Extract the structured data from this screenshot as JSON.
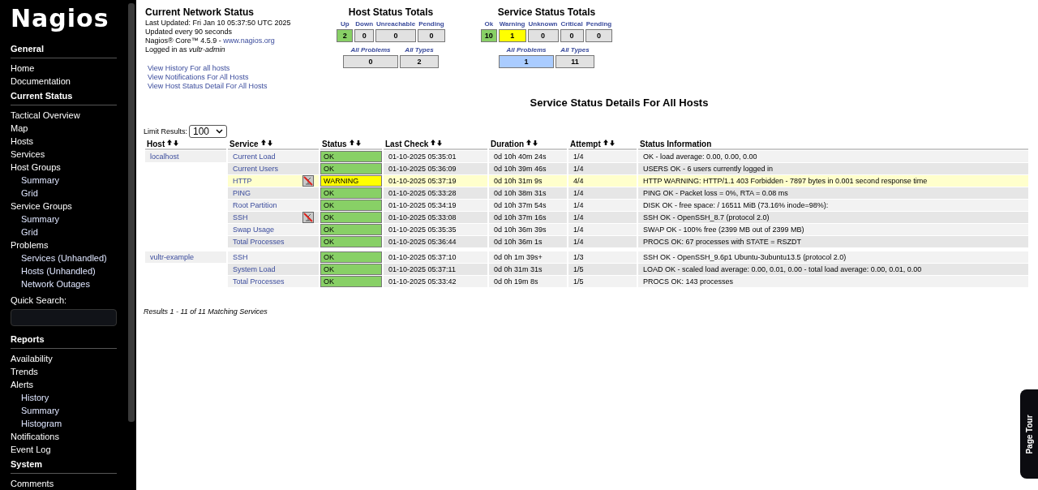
{
  "sidebar": {
    "logo": "Nagios",
    "sections": [
      {
        "title": "General",
        "items": [
          {
            "label": "Home"
          },
          {
            "label": "Documentation"
          }
        ]
      },
      {
        "title": "Current Status",
        "items": [
          {
            "label": "Tactical Overview"
          },
          {
            "label": "Map"
          },
          {
            "label": "Hosts"
          },
          {
            "label": "Services"
          },
          {
            "label": "Host Groups",
            "children": [
              {
                "label": "Summary"
              },
              {
                "label": "Grid"
              }
            ]
          },
          {
            "label": "Service Groups",
            "children": [
              {
                "label": "Summary"
              },
              {
                "label": "Grid"
              }
            ]
          },
          {
            "label": "Problems",
            "children": [
              {
                "label": "Services (Unhandled)"
              },
              {
                "label": "Hosts (Unhandled)"
              },
              {
                "label": "Network Outages"
              }
            ]
          }
        ],
        "search_label": "Quick Search:"
      },
      {
        "title": "Reports",
        "items": [
          {
            "label": "Availability"
          },
          {
            "label": "Trends"
          },
          {
            "label": "Alerts",
            "children": [
              {
                "label": "History"
              },
              {
                "label": "Summary"
              },
              {
                "label": "Histogram"
              }
            ]
          },
          {
            "label": "Notifications"
          },
          {
            "label": "Event Log"
          }
        ]
      },
      {
        "title": "System",
        "items": [
          {
            "label": "Comments"
          }
        ]
      }
    ]
  },
  "network_status": {
    "title": "Current Network Status",
    "last_updated": "Last Updated: Fri Jan 10 05:37:50 UTC 2025",
    "interval": "Updated every 90 seconds",
    "version": "Nagios® Core™ 4.5.9 - ",
    "version_link": "www.nagios.org",
    "logged_in": "Logged in as *vultr-admin*",
    "links": [
      "View History For all hosts",
      "View Notifications For All Hosts",
      "View Host Status Detail For All Hosts"
    ]
  },
  "host_totals": {
    "title": "Host Status Totals",
    "counts": [
      {
        "label": "Up",
        "count": "2",
        "color": "#88d066"
      },
      {
        "label": "Down",
        "count": "0",
        "color": "#e1e1e1"
      },
      {
        "label": "Unreachable",
        "count": "0",
        "color": "#e1e1e1"
      },
      {
        "label": "Pending",
        "count": "0",
        "color": "#e1e1e1"
      }
    ],
    "summary": [
      {
        "label": "All Problems",
        "count": "0",
        "color": "#e1e1e1"
      },
      {
        "label": "All Types",
        "count": "2",
        "color": "#e1e1e1"
      }
    ]
  },
  "service_totals": {
    "title": "Service Status Totals",
    "counts": [
      {
        "label": "Ok",
        "count": "10",
        "color": "#88d066"
      },
      {
        "label": "Warning",
        "count": "1",
        "color": "#ffff00"
      },
      {
        "label": "Unknown",
        "count": "0",
        "color": "#e1e1e1"
      },
      {
        "label": "Critical",
        "count": "0",
        "color": "#e1e1e1"
      },
      {
        "label": "Pending",
        "count": "0",
        "color": "#e1e1e1"
      }
    ],
    "summary": [
      {
        "label": "All Problems",
        "count": "1",
        "color": "#aaccff"
      },
      {
        "label": "All Types",
        "count": "11",
        "color": "#e1e1e1"
      }
    ]
  },
  "details": {
    "title": "Service Status Details For All Hosts",
    "limit_label": "Limit Results:",
    "limit_value": "100",
    "columns": [
      {
        "label": "Host",
        "sortable": true
      },
      {
        "label": "Service",
        "sortable": true
      },
      {
        "label": "Status",
        "sortable": true
      },
      {
        "label": "Last Check",
        "sortable": true
      },
      {
        "label": "Duration",
        "sortable": true
      },
      {
        "label": "Attempt",
        "sortable": true
      },
      {
        "label": "Status Information",
        "sortable": false
      }
    ],
    "hosts": [
      {
        "name": "localhost",
        "services": [
          {
            "name": "Current Load",
            "notifications_disabled": false,
            "status": "OK",
            "kind": "ok",
            "last_check": "01-10-2025 05:35:01",
            "duration": "0d 10h 40m 24s",
            "attempt": "1/4",
            "info": "OK - load average: 0.00, 0.00, 0.00"
          },
          {
            "name": "Current Users",
            "notifications_disabled": false,
            "status": "OK",
            "kind": "ok",
            "last_check": "01-10-2025 05:36:09",
            "duration": "0d 10h 39m 46s",
            "attempt": "1/4",
            "info": "USERS OK - 6 users currently logged in"
          },
          {
            "name": "HTTP",
            "notifications_disabled": true,
            "status": "WARNING",
            "kind": "warning",
            "last_check": "01-10-2025 05:37:19",
            "duration": "0d 10h 31m 9s",
            "attempt": "4/4",
            "info": "HTTP WARNING: HTTP/1.1 403 Forbidden - 7897 bytes in 0.001 second response time"
          },
          {
            "name": "PING",
            "notifications_disabled": false,
            "status": "OK",
            "kind": "ok",
            "last_check": "01-10-2025 05:33:28",
            "duration": "0d 10h 38m 31s",
            "attempt": "1/4",
            "info": "PING OK - Packet loss = 0%, RTA = 0.08 ms"
          },
          {
            "name": "Root Partition",
            "notifications_disabled": false,
            "status": "OK",
            "kind": "ok",
            "last_check": "01-10-2025 05:34:19",
            "duration": "0d 10h 37m 54s",
            "attempt": "1/4",
            "info": "DISK OK - free space: / 16511 MiB (73.16% inode=98%):"
          },
          {
            "name": "SSH",
            "notifications_disabled": true,
            "status": "OK",
            "kind": "ok",
            "last_check": "01-10-2025 05:33:08",
            "duration": "0d 10h 37m 16s",
            "attempt": "1/4",
            "info": "SSH OK - OpenSSH_8.7 (protocol 2.0)"
          },
          {
            "name": "Swap Usage",
            "notifications_disabled": false,
            "status": "OK",
            "kind": "ok",
            "last_check": "01-10-2025 05:35:35",
            "duration": "0d 10h 36m 39s",
            "attempt": "1/4",
            "info": "SWAP OK - 100% free (2399 MB out of 2399 MB)"
          },
          {
            "name": "Total Processes",
            "notifications_disabled": false,
            "status": "OK",
            "kind": "ok",
            "last_check": "01-10-2025 05:36:44",
            "duration": "0d 10h 36m 1s",
            "attempt": "1/4",
            "info": "PROCS OK: 67 processes with STATE = RSZDT"
          }
        ]
      },
      {
        "name": "vultr-example",
        "services": [
          {
            "name": "SSH",
            "notifications_disabled": false,
            "status": "OK",
            "kind": "ok",
            "last_check": "01-10-2025 05:37:10",
            "duration": "0d 0h 1m 39s+",
            "attempt": "1/3",
            "info": "SSH OK - OpenSSH_9.6p1 Ubuntu-3ubuntu13.5 (protocol 2.0)"
          },
          {
            "name": "System Load",
            "notifications_disabled": false,
            "status": "OK",
            "kind": "ok",
            "last_check": "01-10-2025 05:37:11",
            "duration": "0d 0h 31m 31s",
            "attempt": "1/5",
            "info": "LOAD OK - scaled load average: 0.00, 0.01, 0.00 - total load average: 0.00, 0.01, 0.00"
          },
          {
            "name": "Total Processes",
            "notifications_disabled": false,
            "status": "OK",
            "kind": "ok",
            "last_check": "01-10-2025 05:33:42",
            "duration": "0d 0h 19m 8s",
            "attempt": "1/5",
            "info": "PROCS OK: 143 processes"
          }
        ]
      }
    ],
    "results": "Results 1 - 11 of 11 Matching Services"
  },
  "page_tour": "Page Tour"
}
